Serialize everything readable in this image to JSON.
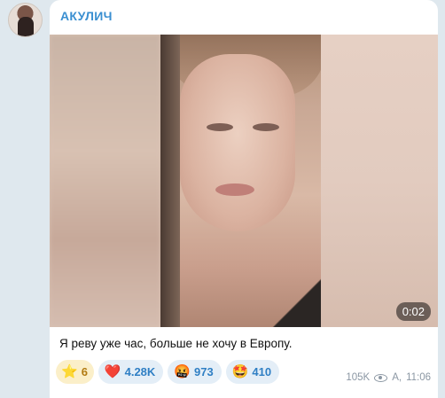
{
  "channel": {
    "name": "АКУЛИЧ"
  },
  "post": {
    "video_duration": "0:02",
    "caption": "Я реву уже час, больше не хочу в Европу.",
    "reactions": [
      {
        "emoji": "⭐",
        "count": "6",
        "kind": "star"
      },
      {
        "emoji": "❤️",
        "count": "4.28K",
        "kind": "heart"
      },
      {
        "emoji": "🤬",
        "count": "973",
        "kind": "angry"
      },
      {
        "emoji": "🤩",
        "count": "410",
        "kind": "star-struck"
      }
    ],
    "views": "105K",
    "author_sign": "А,",
    "time": "11:06"
  },
  "colors": {
    "title": "#3a8fd1",
    "reaction_bg": "#e4eef7",
    "reaction_text": "#2f7fc4",
    "star_bg": "#fbefc9",
    "meta_text": "#8b97a3"
  }
}
